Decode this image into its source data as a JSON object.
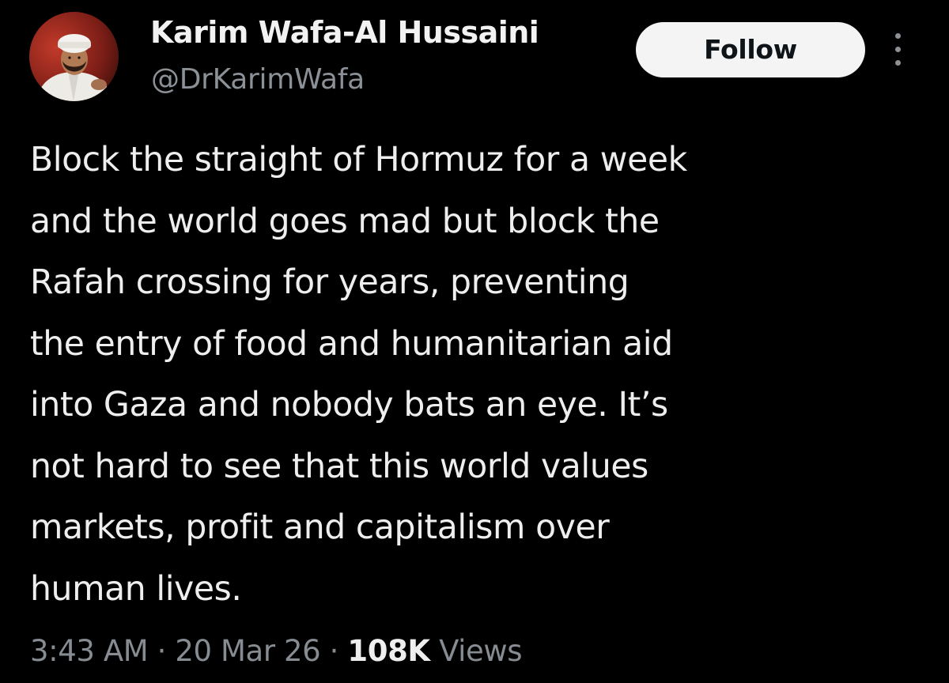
{
  "author": {
    "display_name": "Karim Wafa-Al Hussaini",
    "handle": "@DrKarimWafa"
  },
  "header": {
    "follow_label": "Follow",
    "more_icon": "more-vertical-icon"
  },
  "tweet": {
    "lines": [
      "Block the straight of Hormuz for a week",
      "and the world goes mad but block the",
      "Rafah crossing for years, preventing",
      "the entry of food and humanitarian aid",
      "into Gaza and nobody bats an eye. It’s",
      "not hard to see that this world values",
      "markets, profit and capitalism over",
      "human lives."
    ]
  },
  "meta": {
    "time": "3:43 AM",
    "separator": " · ",
    "date": "20 Mar 26",
    "views_count": "108K",
    "views_label": "Views"
  },
  "colors": {
    "background": "#000000",
    "text_primary": "#eeeeee",
    "text_secondary": "#868c91",
    "follow_bg": "#f4f4f4",
    "follow_text": "#0f1419"
  }
}
